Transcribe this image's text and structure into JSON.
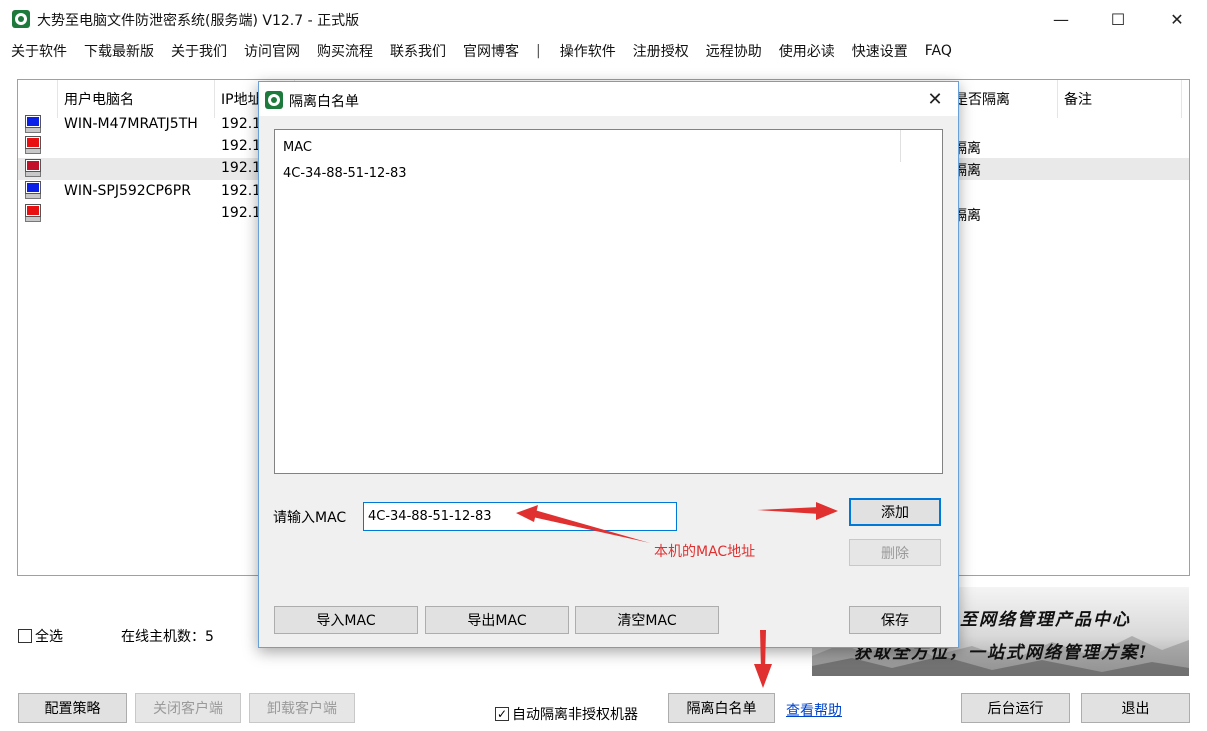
{
  "window": {
    "title": "大势至电脑文件防泄密系统(服务端) V12.7 - 正式版",
    "minimize": "—",
    "maximize": "☐",
    "close": "✕"
  },
  "menu": {
    "items": [
      "关于软件",
      "下载最新版",
      "关于我们",
      "访问官网",
      "购买流程",
      "联系我们",
      "官网博客"
    ],
    "separator": "|",
    "items2": [
      "操作软件",
      "注册授权",
      "远程协助",
      "使用必读",
      "快速设置",
      "FAQ"
    ]
  },
  "table": {
    "headers": {
      "user": "用户电脑名",
      "ip": "IP地址",
      "isolated": "是否隔离",
      "note": "备注"
    },
    "rows": [
      {
        "status_color": "#0a20e8",
        "user": "WIN-M47MRATJ5TH",
        "ip": "192.1",
        "isolated": ""
      },
      {
        "status_color": "#e81010",
        "user": "",
        "ip": "192.1",
        "isolated": "隔离"
      },
      {
        "status_color": "#c0102a",
        "user": "",
        "ip": "192.1",
        "isolated": "隔离"
      },
      {
        "status_color": "#0a20e8",
        "user": "WIN-SPJ592CP6PR",
        "ip": "192.1",
        "isolated": ""
      },
      {
        "status_color": "#e81010",
        "user": "",
        "ip": "192.1",
        "isolated": "隔离"
      }
    ]
  },
  "bottom": {
    "select_all": "全选",
    "online_count_label": "在线主机数：5",
    "buttons": {
      "config": "配置策略",
      "close_client": "关闭客户端",
      "uninstall_client": "卸载客户端",
      "auto_isolate": "自动隔离非授权机器",
      "whitelist": "隔离白名单",
      "help": "查看帮助",
      "background": "后台运行",
      "exit": "退出"
    },
    "auto_isolate_checked": true,
    "banner_line1": "至网络管理产品中心",
    "banner_line2": "获取全方位，一站式网络管理方案!"
  },
  "dialog": {
    "title": "隔离白名单",
    "close": "✕",
    "list_header": "MAC",
    "mac_entries": [
      "4C-34-88-51-12-83"
    ],
    "input_label": "请输入MAC",
    "input_value": "4C-34-88-51-12-83",
    "buttons": {
      "add": "添加",
      "delete": "删除",
      "import": "导入MAC",
      "export": "导出MAC",
      "clear": "清空MAC",
      "save": "保存"
    }
  },
  "annotation": {
    "text": "本机的MAC地址",
    "color": "#e03030"
  }
}
